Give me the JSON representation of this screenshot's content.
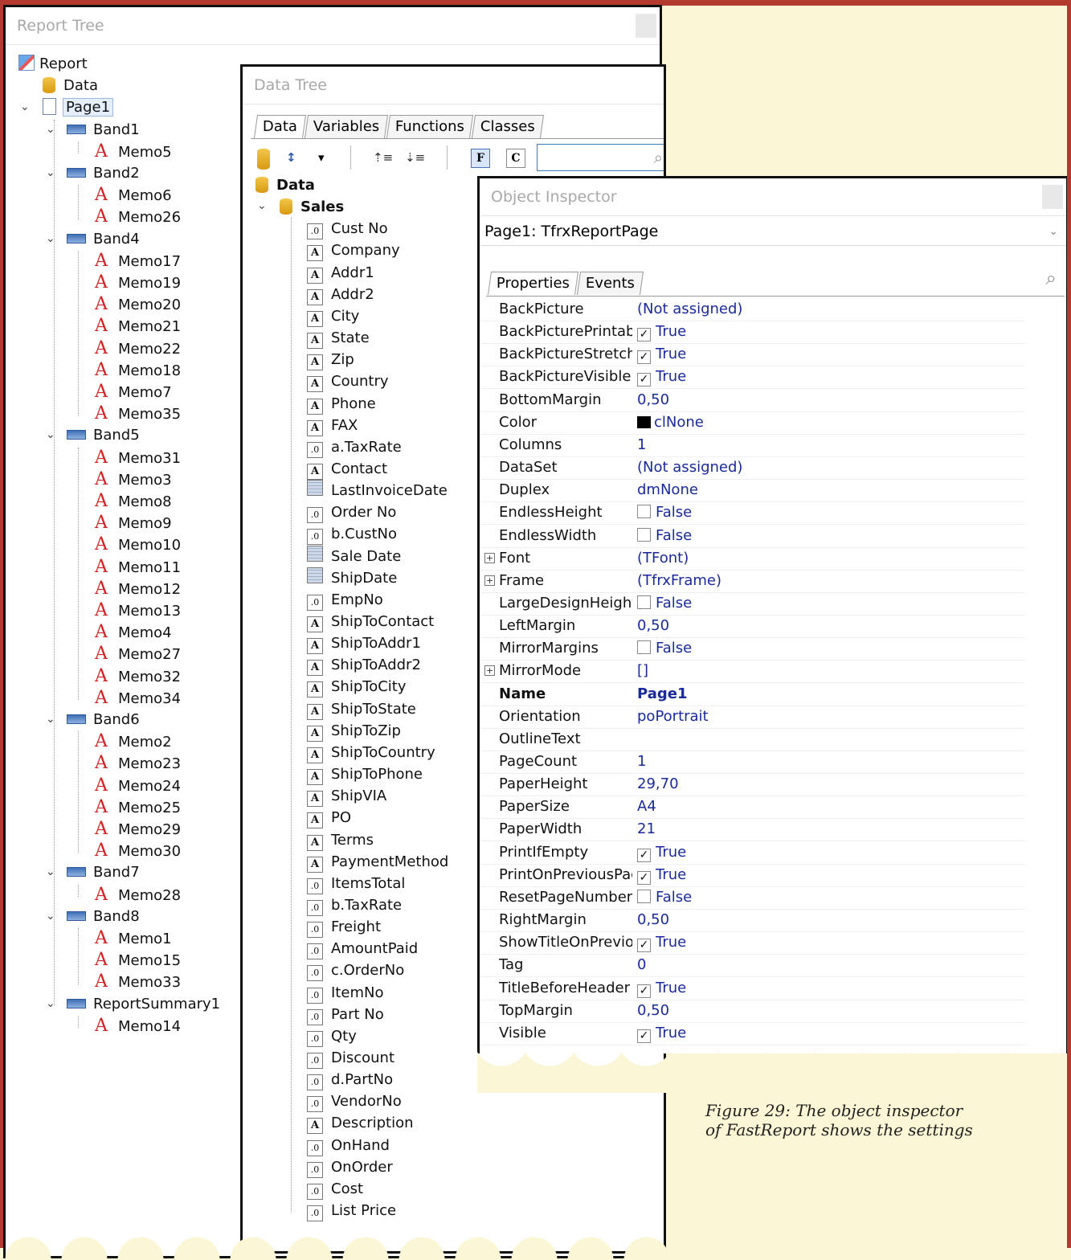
{
  "report_tree": {
    "title": "Report Tree",
    "root": "Report",
    "data": "Data",
    "page": "Page1",
    "bands": [
      {
        "name": "Band1",
        "memos": [
          "Memo5"
        ]
      },
      {
        "name": "Band2",
        "memos": [
          "Memo6",
          "Memo26"
        ]
      },
      {
        "name": "Band4",
        "memos": [
          "Memo17",
          "Memo19",
          "Memo20",
          "Memo21",
          "Memo22",
          "Memo18",
          "Memo7",
          "Memo35"
        ]
      },
      {
        "name": "Band5",
        "memos": [
          "Memo31",
          "Memo3",
          "Memo8",
          "Memo9",
          "Memo10",
          "Memo11",
          "Memo12",
          "Memo13",
          "Memo4",
          "Memo27",
          "Memo32",
          "Memo34"
        ]
      },
      {
        "name": "Band6",
        "memos": [
          "Memo2",
          "Memo23",
          "Memo24",
          "Memo25",
          "Memo29",
          "Memo30"
        ]
      },
      {
        "name": "Band7",
        "memos": [
          "Memo28"
        ]
      },
      {
        "name": "Band8",
        "memos": [
          "Memo1",
          "Memo15",
          "Memo33"
        ]
      },
      {
        "name": "ReportSummary1",
        "memos": [
          "Memo14"
        ]
      }
    ]
  },
  "data_tree": {
    "title": "Data Tree",
    "tabs": [
      "Data",
      "Variables",
      "Functions",
      "Classes"
    ],
    "toolbar": {
      "f_label": "F",
      "c_label": "C"
    },
    "root": "Data",
    "dataset": "Sales",
    "fields": [
      {
        "label": "Cust No",
        "type": "num"
      },
      {
        "label": "Company",
        "type": "text"
      },
      {
        "label": "Addr1",
        "type": "text"
      },
      {
        "label": "Addr2",
        "type": "text"
      },
      {
        "label": "City",
        "type": "text"
      },
      {
        "label": "State",
        "type": "text"
      },
      {
        "label": "Zip",
        "type": "text"
      },
      {
        "label": "Country",
        "type": "text"
      },
      {
        "label": "Phone",
        "type": "text"
      },
      {
        "label": "FAX",
        "type": "text"
      },
      {
        "label": "a.TaxRate",
        "type": "num"
      },
      {
        "label": "Contact",
        "type": "text"
      },
      {
        "label": "LastInvoiceDate",
        "type": "date"
      },
      {
        "label": "Order No",
        "type": "num"
      },
      {
        "label": "b.CustNo",
        "type": "num"
      },
      {
        "label": "Sale Date",
        "type": "date"
      },
      {
        "label": "ShipDate",
        "type": "date"
      },
      {
        "label": "EmpNo",
        "type": "num"
      },
      {
        "label": "ShipToContact",
        "type": "text"
      },
      {
        "label": "ShipToAddr1",
        "type": "text"
      },
      {
        "label": "ShipToAddr2",
        "type": "text"
      },
      {
        "label": "ShipToCity",
        "type": "text"
      },
      {
        "label": "ShipToState",
        "type": "text"
      },
      {
        "label": "ShipToZip",
        "type": "text"
      },
      {
        "label": "ShipToCountry",
        "type": "text"
      },
      {
        "label": "ShipToPhone",
        "type": "text"
      },
      {
        "label": "ShipVIA",
        "type": "text"
      },
      {
        "label": "PO",
        "type": "text"
      },
      {
        "label": "Terms",
        "type": "text"
      },
      {
        "label": "PaymentMethod",
        "type": "text"
      },
      {
        "label": "ItemsTotal",
        "type": "num"
      },
      {
        "label": "b.TaxRate",
        "type": "num"
      },
      {
        "label": "Freight",
        "type": "num"
      },
      {
        "label": "AmountPaid",
        "type": "num"
      },
      {
        "label": "c.OrderNo",
        "type": "num"
      },
      {
        "label": "ItemNo",
        "type": "num"
      },
      {
        "label": "Part No",
        "type": "num"
      },
      {
        "label": "Qty",
        "type": "num"
      },
      {
        "label": "Discount",
        "type": "num"
      },
      {
        "label": "d.PartNo",
        "type": "num"
      },
      {
        "label": "VendorNo",
        "type": "num"
      },
      {
        "label": "Description",
        "type": "text"
      },
      {
        "label": "OnHand",
        "type": "num"
      },
      {
        "label": "OnOrder",
        "type": "num"
      },
      {
        "label": "Cost",
        "type": "num"
      },
      {
        "label": "List Price",
        "type": "num"
      }
    ]
  },
  "object_inspector": {
    "title": "Object Inspector",
    "selected_object": "Page1: TfrxReportPage",
    "tabs": [
      "Properties",
      "Events"
    ],
    "properties": [
      {
        "name": "BackPicture",
        "value": "(Not assigned)"
      },
      {
        "name": "BackPicturePrintable",
        "value": "True",
        "check": true
      },
      {
        "name": "BackPictureStretched",
        "value": "True",
        "check": true
      },
      {
        "name": "BackPictureVisible",
        "value": "True",
        "check": true
      },
      {
        "name": "BottomMargin",
        "value": "0,50"
      },
      {
        "name": "Color",
        "value": "clNone",
        "swatch": true
      },
      {
        "name": "Columns",
        "value": "1"
      },
      {
        "name": "DataSet",
        "value": "(Not assigned)"
      },
      {
        "name": "Duplex",
        "value": "dmNone"
      },
      {
        "name": "EndlessHeight",
        "value": "False",
        "check": false
      },
      {
        "name": "EndlessWidth",
        "value": "False",
        "check": false
      },
      {
        "name": "Font",
        "value": "(TFont)",
        "expand": true
      },
      {
        "name": "Frame",
        "value": "(TfrxFrame)",
        "expand": true
      },
      {
        "name": "LargeDesignHeight",
        "value": "False",
        "check": false
      },
      {
        "name": "LeftMargin",
        "value": "0,50"
      },
      {
        "name": "MirrorMargins",
        "value": "False",
        "check": false
      },
      {
        "name": "MirrorMode",
        "value": "[]",
        "expand": true
      },
      {
        "name": "Name",
        "value": "Page1",
        "bold": true
      },
      {
        "name": "Orientation",
        "value": "poPortrait"
      },
      {
        "name": "OutlineText",
        "value": ""
      },
      {
        "name": "PageCount",
        "value": "1"
      },
      {
        "name": "PaperHeight",
        "value": "29,70"
      },
      {
        "name": "PaperSize",
        "value": "A4"
      },
      {
        "name": "PaperWidth",
        "value": "21"
      },
      {
        "name": "PrintIfEmpty",
        "value": "True",
        "check": true
      },
      {
        "name": "PrintOnPreviousPage",
        "value": "True",
        "check": true
      },
      {
        "name": "ResetPageNumbers",
        "value": "False",
        "check": false
      },
      {
        "name": "RightMargin",
        "value": "0,50"
      },
      {
        "name": "ShowTitleOnPreviousPage",
        "value": "True",
        "check": true
      },
      {
        "name": "Tag",
        "value": "0"
      },
      {
        "name": "TitleBeforeHeader",
        "value": "True",
        "check": true
      },
      {
        "name": "TopMargin",
        "value": "0,50"
      },
      {
        "name": "Visible",
        "value": "True",
        "check": true
      }
    ]
  },
  "caption": {
    "line1": "Figure 29: The object inspector",
    "line2": "of FastReport shows the settings"
  }
}
